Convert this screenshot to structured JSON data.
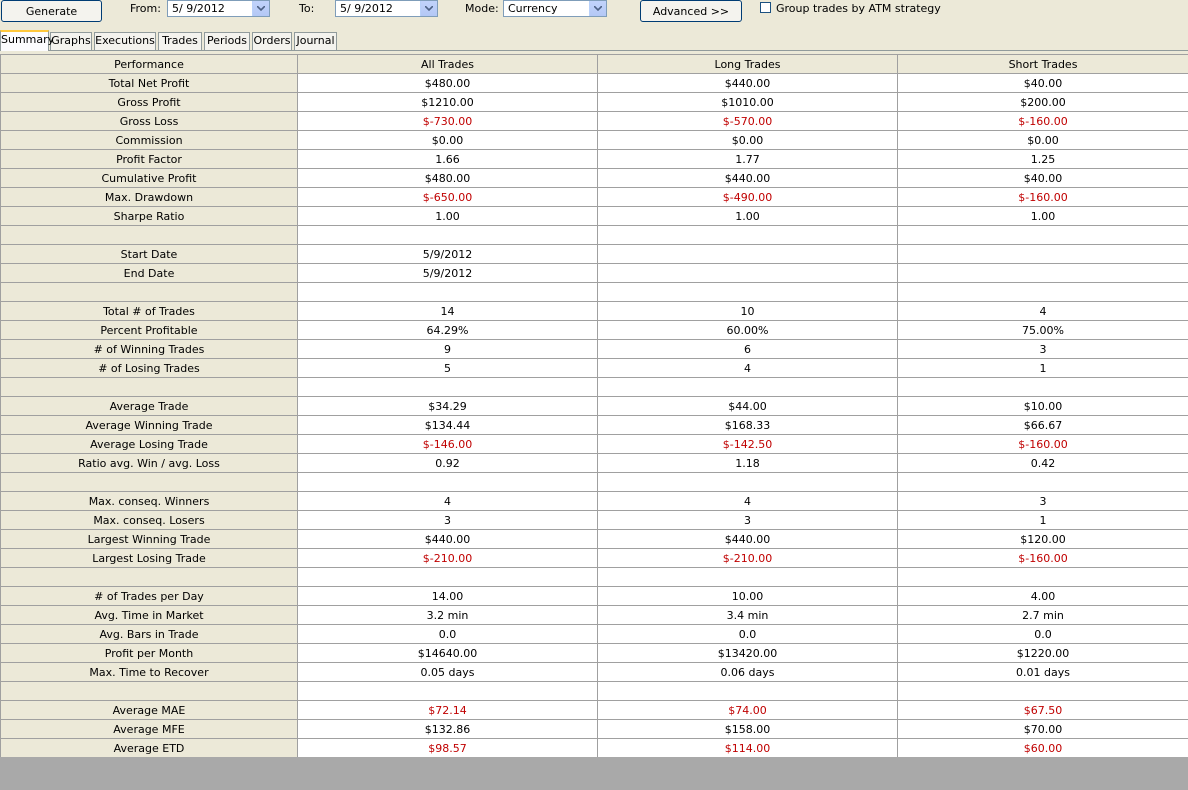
{
  "toolbar": {
    "generate_label": "Generate",
    "from_label": "From:",
    "from_value": "5/ 9/2012",
    "to_label": "To:",
    "to_value": "5/ 9/2012",
    "mode_label": "Mode:",
    "mode_value": "Currency",
    "advanced_label": "Advanced >>",
    "group_trades_label": "Group trades by ATM strategy",
    "group_trades_checked": false
  },
  "tabs": [
    "Summary",
    "Graphs",
    "Executions",
    "Trades",
    "Periods",
    "Orders",
    "Journal"
  ],
  "active_tab": "Summary",
  "table": {
    "headers": [
      "Performance",
      "All Trades",
      "Long Trades",
      "Short Trades"
    ],
    "rows": [
      {
        "label": "Total Net Profit",
        "all": "$480.00",
        "long": "$440.00",
        "short": "$40.00",
        "neg": false
      },
      {
        "label": "Gross Profit",
        "all": "$1210.00",
        "long": "$1010.00",
        "short": "$200.00",
        "neg": false
      },
      {
        "label": "Gross Loss",
        "all": "$-730.00",
        "long": "$-570.00",
        "short": "$-160.00",
        "neg": true
      },
      {
        "label": "Commission",
        "all": "$0.00",
        "long": "$0.00",
        "short": "$0.00",
        "neg": false
      },
      {
        "label": "Profit Factor",
        "all": "1.66",
        "long": "1.77",
        "short": "1.25",
        "neg": false
      },
      {
        "label": "Cumulative Profit",
        "all": "$480.00",
        "long": "$440.00",
        "short": "$40.00",
        "neg": false
      },
      {
        "label": "Max. Drawdown",
        "all": "$-650.00",
        "long": "$-490.00",
        "short": "$-160.00",
        "neg": true
      },
      {
        "label": "Sharpe Ratio",
        "all": "1.00",
        "long": "1.00",
        "short": "1.00",
        "neg": false
      },
      {
        "label": "",
        "all": "",
        "long": "",
        "short": "",
        "neg": false
      },
      {
        "label": "Start Date",
        "all": "5/9/2012",
        "long": "",
        "short": "",
        "neg": false
      },
      {
        "label": "End Date",
        "all": "5/9/2012",
        "long": "",
        "short": "",
        "neg": false
      },
      {
        "label": "",
        "all": "",
        "long": "",
        "short": "",
        "neg": false
      },
      {
        "label": "Total # of Trades",
        "all": "14",
        "long": "10",
        "short": "4",
        "neg": false
      },
      {
        "label": "Percent Profitable",
        "all": "64.29%",
        "long": "60.00%",
        "short": "75.00%",
        "neg": false
      },
      {
        "label": "# of Winning Trades",
        "all": "9",
        "long": "6",
        "short": "3",
        "neg": false
      },
      {
        "label": "# of Losing Trades",
        "all": "5",
        "long": "4",
        "short": "1",
        "neg": false
      },
      {
        "label": "",
        "all": "",
        "long": "",
        "short": "",
        "neg": false
      },
      {
        "label": "Average Trade",
        "all": "$34.29",
        "long": "$44.00",
        "short": "$10.00",
        "neg": false
      },
      {
        "label": "Average Winning Trade",
        "all": "$134.44",
        "long": "$168.33",
        "short": "$66.67",
        "neg": false
      },
      {
        "label": "Average Losing Trade",
        "all": "$-146.00",
        "long": "$-142.50",
        "short": "$-160.00",
        "neg": true
      },
      {
        "label": "Ratio avg. Win / avg. Loss",
        "all": "0.92",
        "long": "1.18",
        "short": "0.42",
        "neg": false
      },
      {
        "label": "",
        "all": "",
        "long": "",
        "short": "",
        "neg": false
      },
      {
        "label": "Max. conseq. Winners",
        "all": "4",
        "long": "4",
        "short": "3",
        "neg": false
      },
      {
        "label": "Max. conseq. Losers",
        "all": "3",
        "long": "3",
        "short": "1",
        "neg": false
      },
      {
        "label": "Largest Winning Trade",
        "all": "$440.00",
        "long": "$440.00",
        "short": "$120.00",
        "neg": false
      },
      {
        "label": "Largest Losing Trade",
        "all": "$-210.00",
        "long": "$-210.00",
        "short": "$-160.00",
        "neg": true
      },
      {
        "label": "",
        "all": "",
        "long": "",
        "short": "",
        "neg": false
      },
      {
        "label": "# of Trades per Day",
        "all": "14.00",
        "long": "10.00",
        "short": "4.00",
        "neg": false
      },
      {
        "label": "Avg. Time in Market",
        "all": "3.2 min",
        "long": "3.4 min",
        "short": "2.7 min",
        "neg": false
      },
      {
        "label": "Avg. Bars in Trade",
        "all": "0.0",
        "long": "0.0",
        "short": "0.0",
        "neg": false
      },
      {
        "label": "Profit per Month",
        "all": "$14640.00",
        "long": "$13420.00",
        "short": "$1220.00",
        "neg": false
      },
      {
        "label": "Max. Time to Recover",
        "all": "0.05 days",
        "long": "0.06 days",
        "short": "0.01 days",
        "neg": false
      },
      {
        "label": "",
        "all": "",
        "long": "",
        "short": "",
        "neg": false
      },
      {
        "label": "Average MAE",
        "all": "$72.14",
        "long": "$74.00",
        "short": "$67.50",
        "neg": true
      },
      {
        "label": "Average MFE",
        "all": "$132.86",
        "long": "$158.00",
        "short": "$70.00",
        "neg": false
      },
      {
        "label": "Average ETD",
        "all": "$98.57",
        "long": "$114.00",
        "short": "$60.00",
        "neg": true
      }
    ]
  },
  "colors": {
    "negative": "#c00000",
    "panel": "#ece9d8",
    "tab_highlight": "#ffc83c"
  }
}
